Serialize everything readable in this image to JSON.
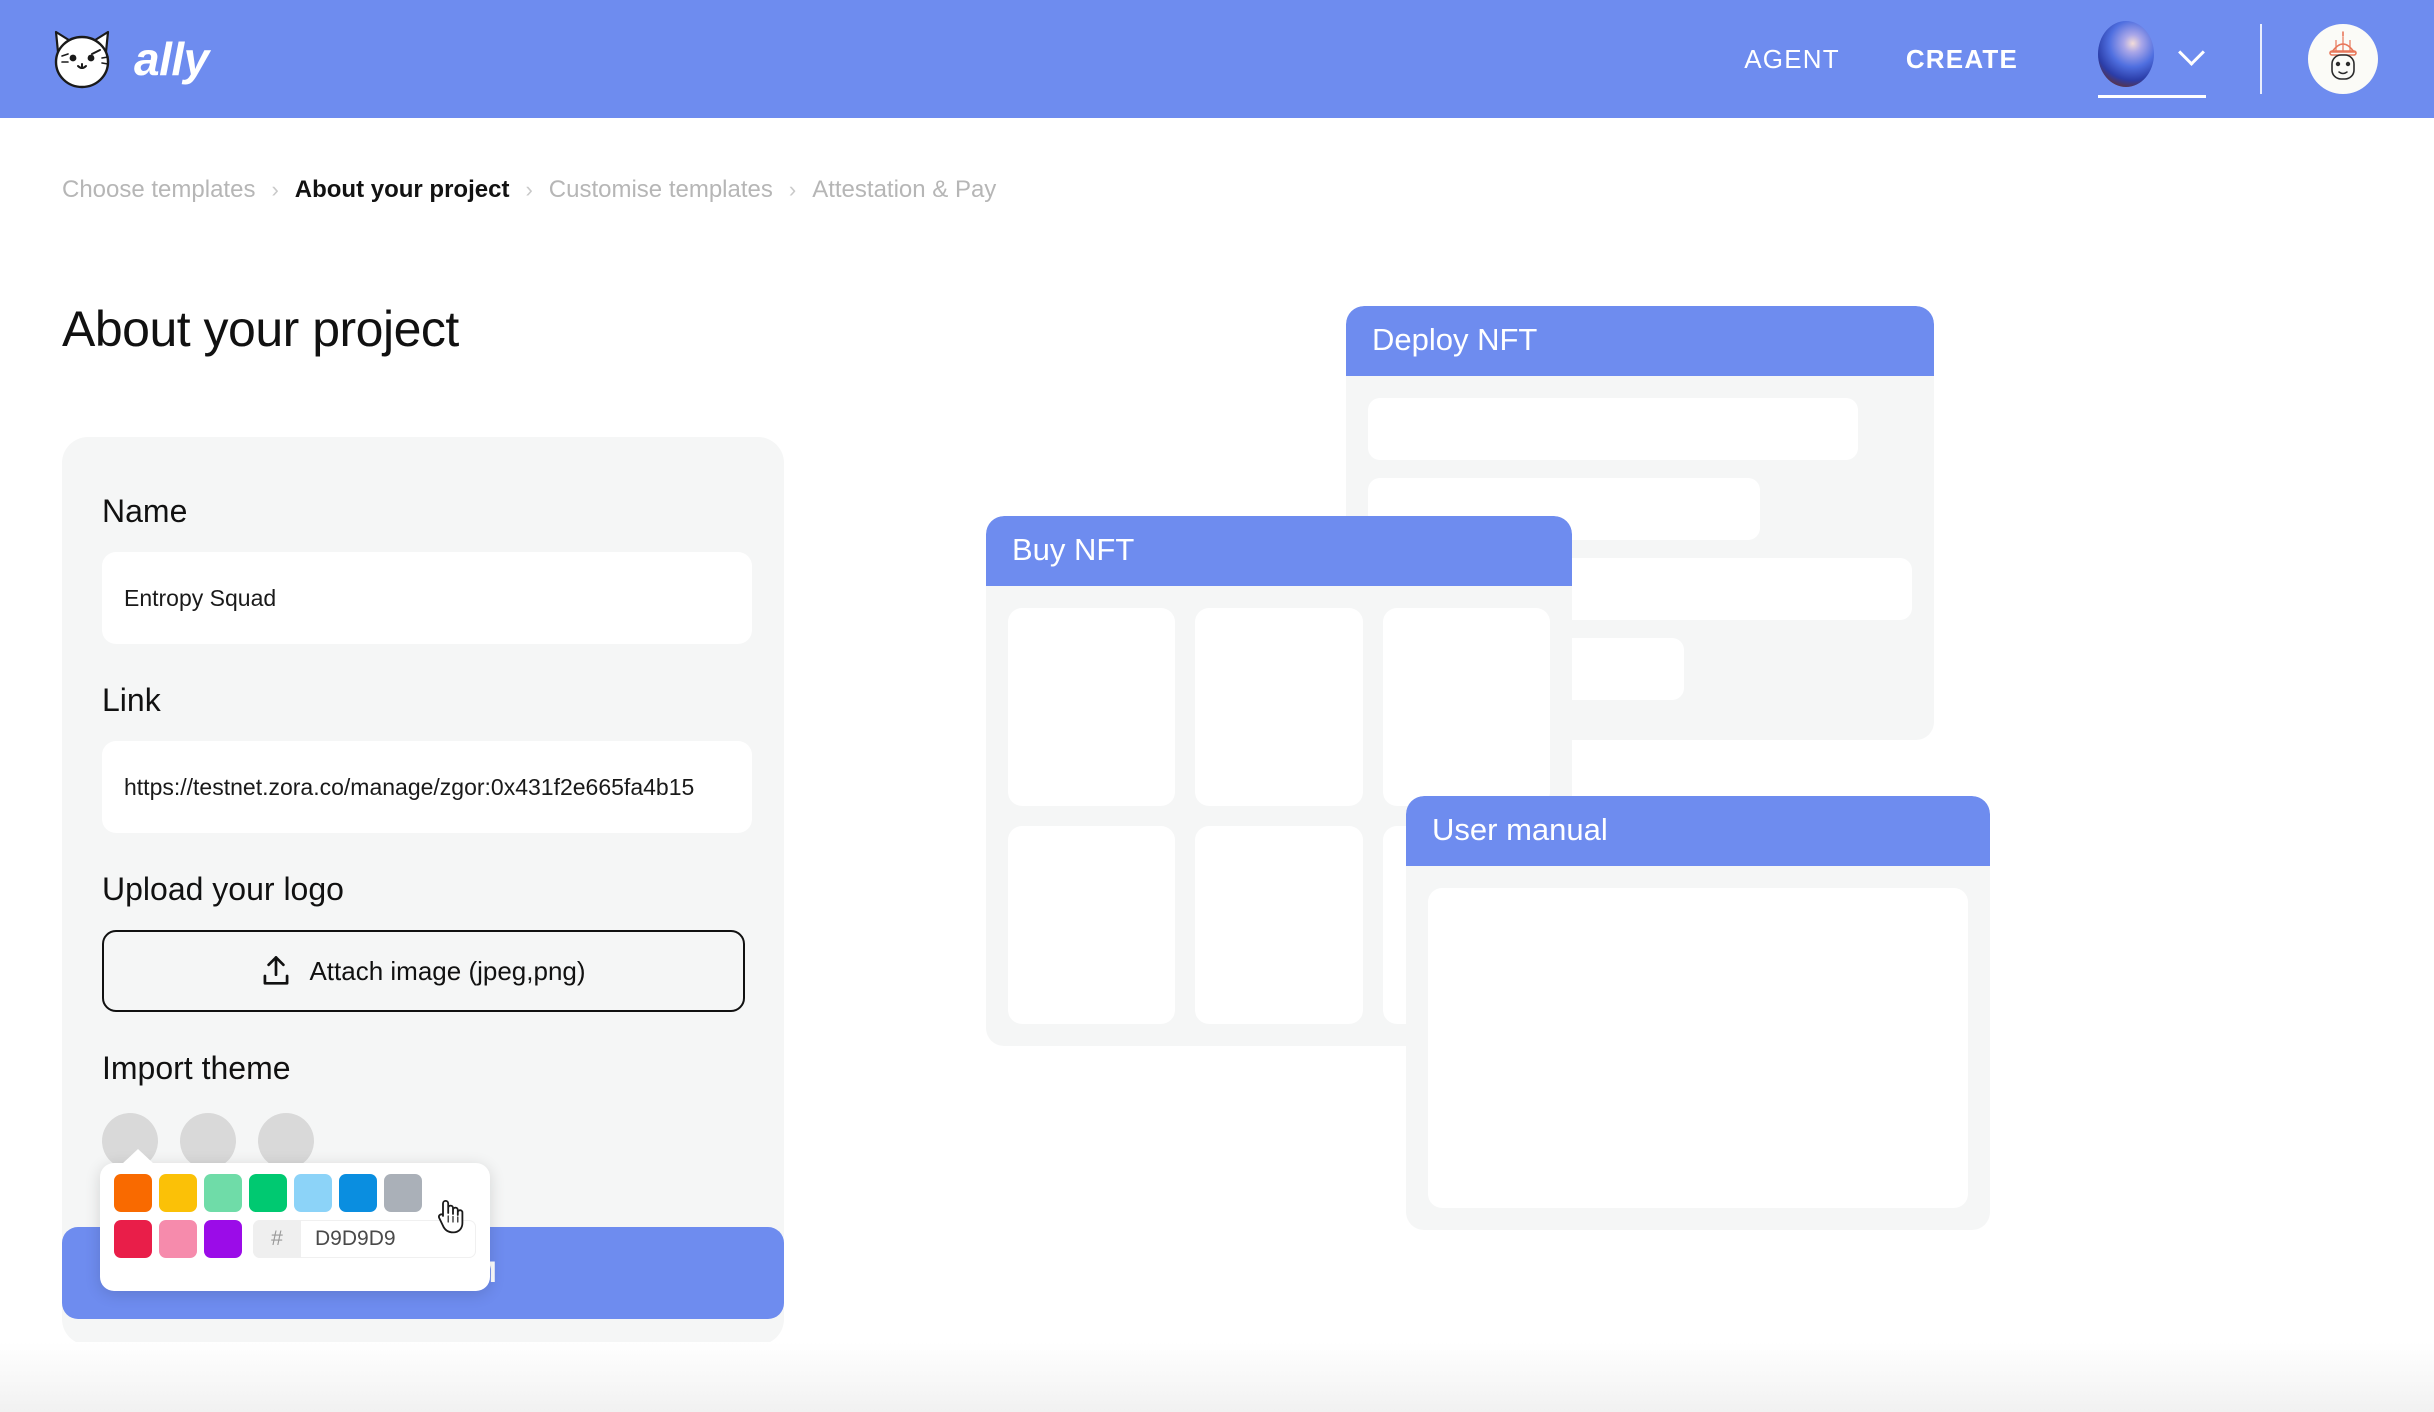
{
  "topbar": {
    "brand_name": "ally",
    "logo_icon": "cat-face-icon",
    "nav": [
      {
        "label": "AGENT",
        "active": false
      },
      {
        "label": "CREATE",
        "active": true
      }
    ],
    "wallet": {
      "icon": "gradient-orb-icon",
      "chevron_icon": "chevron-down-icon"
    },
    "avatar_icon": "user-avatar-icon",
    "bg_color": "#6E8CEF"
  },
  "breadcrumb": {
    "items": [
      {
        "label": "Choose templates",
        "active": false
      },
      {
        "label": "About your project",
        "active": true
      },
      {
        "label": "Customise templates",
        "active": false
      },
      {
        "label": "Attestation & Pay",
        "active": false
      }
    ],
    "separator": "›"
  },
  "page": {
    "title": "About your project"
  },
  "form": {
    "name": {
      "label": "Name",
      "value": "Entropy Squad",
      "placeholder": "Name"
    },
    "link": {
      "label": "Link",
      "value": "https://testnet.zora.co/manage/zgor:0x431f2e665fa4b15",
      "placeholder": "Link"
    },
    "logo": {
      "label": "Upload your logo",
      "button_label": "Attach image (jpeg,png)",
      "icon": "upload-icon"
    },
    "theme": {
      "label": "Import theme",
      "circles": [
        "#D9D9D9",
        "#D9D9D9",
        "#D9D9D9"
      ]
    },
    "confirm_label": "CONFIRM"
  },
  "color_picker": {
    "row1": [
      "#F96A00",
      "#FBC107",
      "#6FDCA8",
      "#00C971",
      "#8CD3F8",
      "#0A8EE0",
      "#AAB0B8"
    ],
    "row2": [
      "#E91E49",
      "#F68BAC",
      "#9B0CE8"
    ],
    "hash_prefix": "#",
    "hex_value": "D9D9D9",
    "hex_placeholder": "D9D9D9",
    "cursor_icon": "pointer-hand-cursor"
  },
  "previews": [
    {
      "id": "deploy",
      "title": "Deploy NFT",
      "layout": "bars",
      "bars": [
        90,
        72,
        100,
        58
      ]
    },
    {
      "id": "buy",
      "title": "Buy NFT",
      "layout": "grid",
      "tiles": 6
    },
    {
      "id": "manual",
      "title": "User manual",
      "layout": "panel"
    }
  ],
  "colors": {
    "brand_blue": "#6E8CEF",
    "panel_gray": "#F5F6F6",
    "circle_gray": "#D9D9D9",
    "text_muted": "#B6B6B6"
  }
}
